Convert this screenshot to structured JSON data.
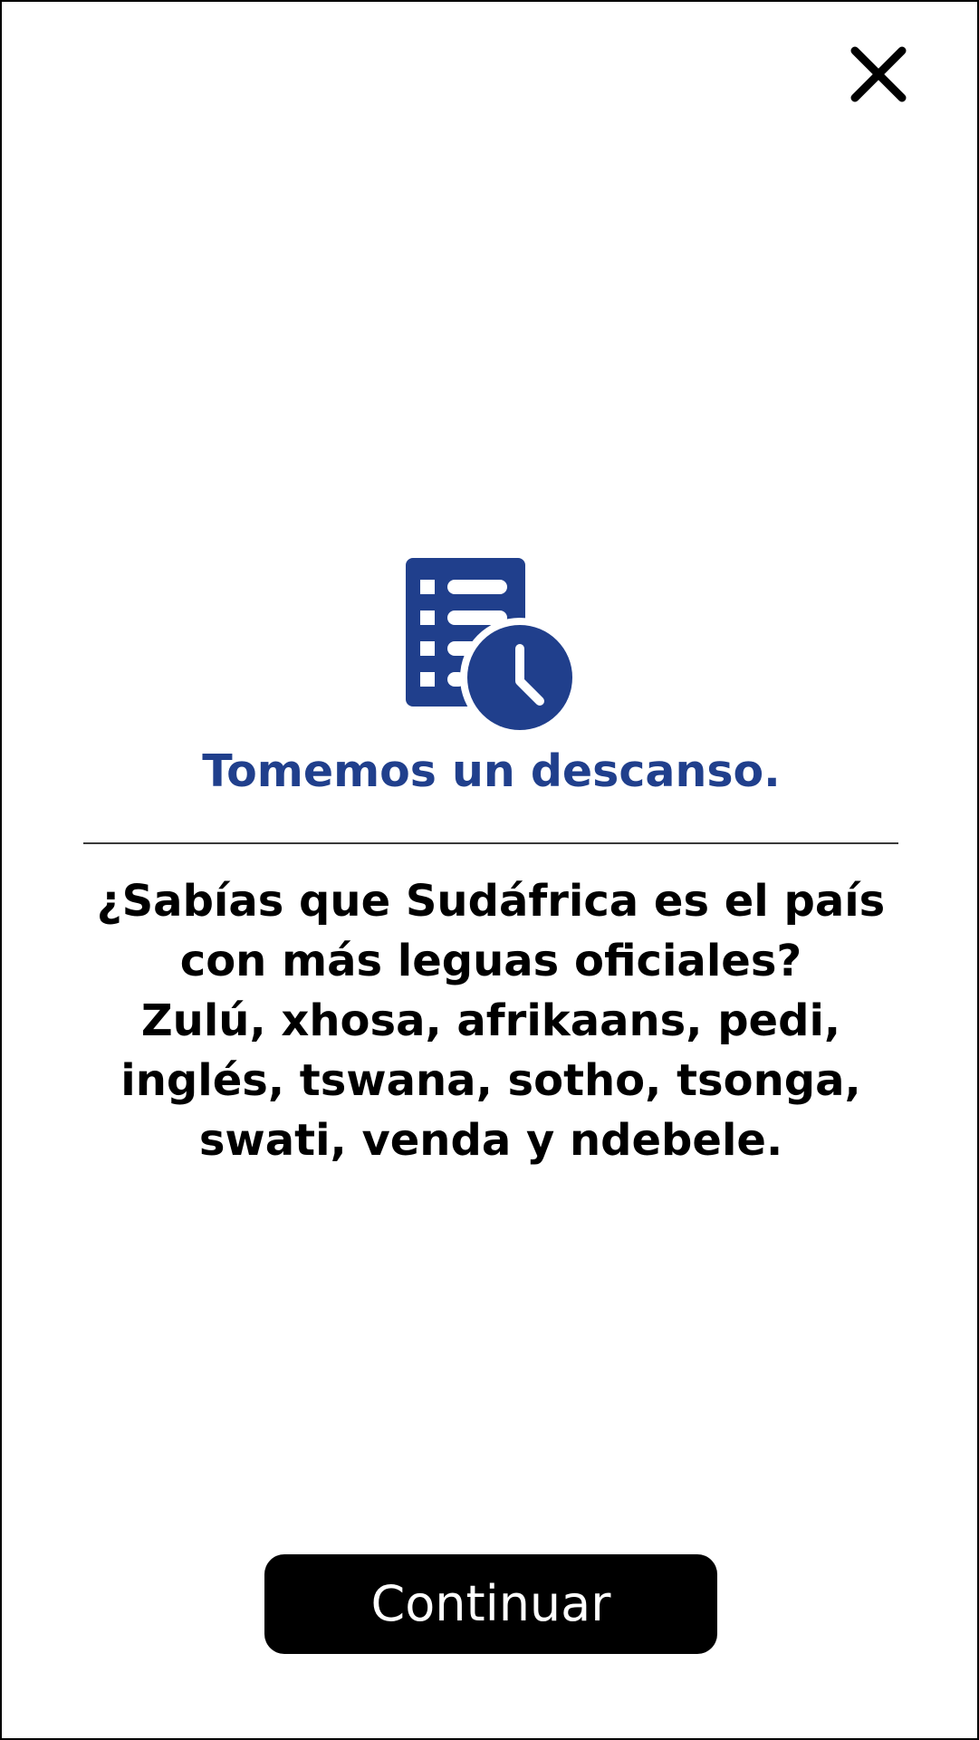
{
  "dialog": {
    "close_icon": "close-icon",
    "hero_icon": "schedule-list-clock-icon",
    "title": "Tomemos un descanso.",
    "message_lines": [
      "¿Sabías que Sudáfrica es el país",
      "con más leguas oficiales?",
      "Zulú, xhosa, afrikaans, pedi,",
      "inglés, tswana, sotho, tsonga,",
      "swati, venda y ndebele."
    ],
    "continue_label": "Continuar"
  },
  "colors": {
    "accent": "#203f8c",
    "background": "#ffffff",
    "text": "#000000",
    "button_bg": "#000000",
    "button_text": "#ffffff"
  }
}
